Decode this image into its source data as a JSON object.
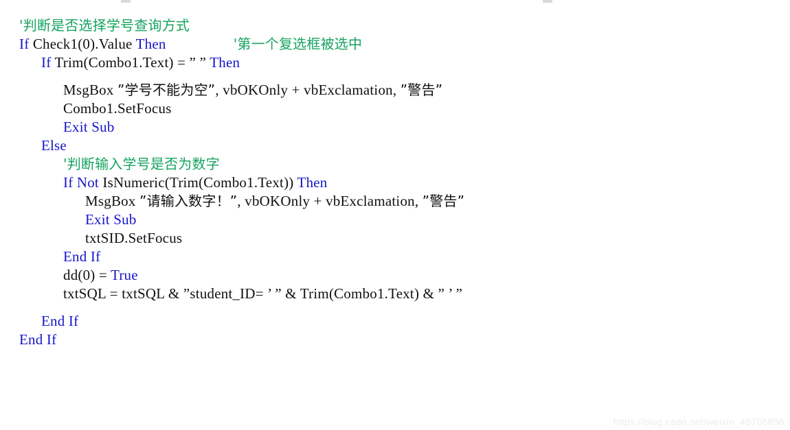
{
  "document": {
    "kind": "code-screenshot",
    "language": "Visual Basic 6",
    "watermark": "https://blog.csdn.net/weixin_45706856",
    "colors": {
      "background": "#ffffff",
      "keyword": "#1515c8",
      "comment": "#11a05a",
      "plain": "#101010",
      "watermark": "#ececec"
    }
  },
  "code": {
    "lines": [
      {
        "id": "line-1",
        "indent": 0,
        "segments": [
          {
            "type": "comment",
            "text": "'判断是否选择学号查询方式",
            "cjk": true
          }
        ]
      },
      {
        "id": "line-2",
        "indent": 0,
        "segments": [
          {
            "type": "keyword",
            "text": "If "
          },
          {
            "type": "plain",
            "text": "Check1(0).Value "
          },
          {
            "type": "keyword",
            "text": "Then"
          },
          {
            "type": "plain",
            "text": "                  "
          },
          {
            "type": "comment",
            "text": "'第一个复选框被选中",
            "cjk": true
          }
        ]
      },
      {
        "id": "line-3",
        "indent": 1,
        "segments": [
          {
            "type": "keyword",
            "text": "If "
          },
          {
            "type": "plain",
            "text": "Trim(Combo1.Text) = ” ” "
          },
          {
            "type": "keyword",
            "text": "Then"
          }
        ]
      },
      {
        "id": "line-4",
        "indent": 0,
        "blank": true,
        "segments": []
      },
      {
        "id": "line-5",
        "indent": 2,
        "segments": [
          {
            "type": "plain",
            "text": "MsgBox "
          },
          {
            "type": "plain",
            "text": "”学号不能为空”",
            "cjk": true
          },
          {
            "type": "plain",
            "text": ", vbOKOnly + vbExclamation, "
          },
          {
            "type": "plain",
            "text": "”警告”",
            "cjk": true
          }
        ]
      },
      {
        "id": "line-6",
        "indent": 2,
        "segments": [
          {
            "type": "plain",
            "text": "Combo1.SetFocus"
          }
        ]
      },
      {
        "id": "line-7",
        "indent": 2,
        "segments": [
          {
            "type": "keyword",
            "text": "Exit Sub"
          }
        ]
      },
      {
        "id": "line-8",
        "indent": 1,
        "segments": [
          {
            "type": "keyword",
            "text": "Else"
          }
        ]
      },
      {
        "id": "line-9",
        "indent": 2,
        "segments": [
          {
            "type": "comment",
            "text": "'判断输入学号是否为数字",
            "cjk": true
          }
        ]
      },
      {
        "id": "line-10",
        "indent": 2,
        "segments": [
          {
            "type": "keyword",
            "text": "If "
          },
          {
            "type": "keyword",
            "text": "Not "
          },
          {
            "type": "plain",
            "text": "IsNumeric(Trim(Combo1.Text)) "
          },
          {
            "type": "keyword",
            "text": "Then"
          }
        ]
      },
      {
        "id": "line-11",
        "indent": 3,
        "segments": [
          {
            "type": "plain",
            "text": "MsgBox "
          },
          {
            "type": "plain",
            "text": "”请输入数字！”",
            "cjk": true
          },
          {
            "type": "plain",
            "text": ", vbOKOnly + vbExclamation, "
          },
          {
            "type": "plain",
            "text": "”警告”",
            "cjk": true
          }
        ]
      },
      {
        "id": "line-12",
        "indent": 3,
        "segments": [
          {
            "type": "keyword",
            "text": "Exit Sub"
          }
        ]
      },
      {
        "id": "line-13",
        "indent": 3,
        "segments": [
          {
            "type": "plain",
            "text": "txtSID.SetFocus"
          }
        ]
      },
      {
        "id": "line-14",
        "indent": 2,
        "segments": [
          {
            "type": "keyword",
            "text": "End If"
          }
        ]
      },
      {
        "id": "line-15",
        "indent": 2,
        "segments": [
          {
            "type": "plain",
            "text": "dd(0) = "
          },
          {
            "type": "keyword",
            "text": "True"
          }
        ]
      },
      {
        "id": "line-16",
        "indent": 2,
        "segments": [
          {
            "type": "plain",
            "text": "txtSQL = txtSQL & ”student_ID= ’ ” & Trim(Combo1.Text) & ” ’ ”"
          }
        ]
      },
      {
        "id": "line-17",
        "indent": 0,
        "blank": true,
        "segments": []
      },
      {
        "id": "line-18",
        "indent": 1,
        "segments": [
          {
            "type": "keyword",
            "text": "End If"
          }
        ]
      },
      {
        "id": "line-19",
        "indent": 0,
        "segments": [
          {
            "type": "keyword",
            "text": "End If"
          }
        ]
      }
    ]
  }
}
